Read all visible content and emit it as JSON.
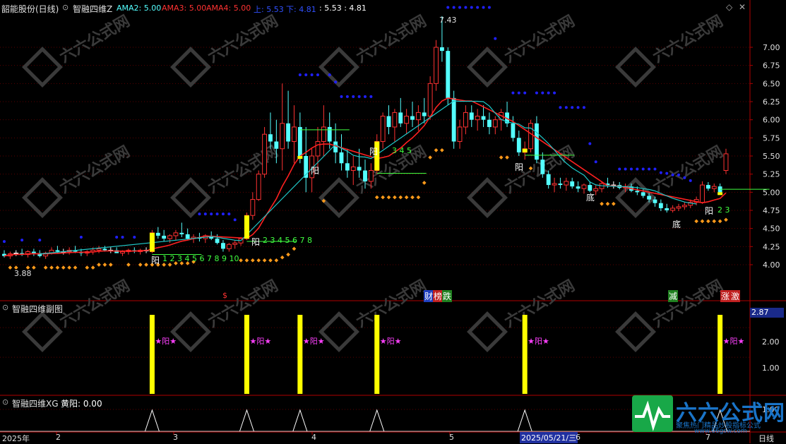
{
  "colors": {
    "bg": "#000000",
    "up": "#ff3232",
    "down": "#54ffff",
    "doji": "#ffffff",
    "grid": "#5a0000",
    "axis": "#b00000",
    "upper_band": "#2020ff",
    "lower_band": "#ff9a1a",
    "ma_red": "#ff2020",
    "ma_cyan": "#20c8c8",
    "yellow": "#ffff00",
    "magenta": "#ff40ff",
    "green": "#40ff40",
    "watermark": "#3a3a3a"
  },
  "header": {
    "stock": "韶能股份(日线)",
    "indicator": "智融四维Z",
    "ama2_label": "AMA2: 5.00",
    "ama3_label": "AMA3: 5.00",
    "ama4_label": "AMA4: 5.00",
    "up_label": "上: 5.53",
    "down_label": "下: 4.81",
    "extra_label": ": 5.53 : 4.81",
    "diamond_icon": "diamond-icon",
    "close_icon": "close-icon"
  },
  "main_panel": {
    "high_label": "7.43",
    "low_label": "3.88",
    "y_ticks": [
      "7.00",
      "6.75",
      "6.50",
      "6.25",
      "6.00",
      "5.75",
      "5.50",
      "5.25",
      "5.00",
      "4.75",
      "4.50",
      "4.25",
      "4.00"
    ],
    "signals": {
      "yang": "阳",
      "di": "底"
    },
    "counters": [
      {
        "text": "1 2 3 4 5 6 7 8 9 10"
      },
      {
        "text": "2 3 4 5 6 7 8"
      },
      {
        "text": "3 4 5"
      },
      {
        "text": "2 3"
      }
    ],
    "bottom_markers": {
      "s": "$",
      "cai": "财",
      "ban": "榜",
      "die": "跌",
      "jian": "减",
      "zhang": "涨",
      "ji": "激"
    }
  },
  "sub_panel": {
    "title": "智融四维副图",
    "value_box": "2.87",
    "y_ticks": [
      "2.00",
      "1.00"
    ],
    "bar_label": "★阳★"
  },
  "xg_panel": {
    "title": "智融四维XG",
    "value_label": "黄阳: 0.00",
    "y_tick": "1.00"
  },
  "x_axis": {
    "labels": [
      "2025年",
      "2",
      "3",
      "4",
      "5",
      "6",
      "7"
    ],
    "date_highlight": "2025/05/21/三",
    "period": "日线"
  },
  "watermark": {
    "logo_text": "六六公式网",
    "slogan": "聚焦热门精品炒股指标公式",
    "url": "www.66gsw.com"
  },
  "chart_data": {
    "type": "candlestick",
    "title": "韶能股份(日线)",
    "ylim": [
      3.7,
      7.5
    ],
    "candles": [
      [
        4.15,
        4.2,
        4.1,
        4.12
      ],
      [
        4.12,
        4.18,
        4.08,
        4.15
      ],
      [
        4.15,
        4.2,
        4.12,
        4.16
      ],
      [
        4.16,
        4.22,
        4.12,
        4.14
      ],
      [
        4.14,
        4.2,
        4.1,
        4.18
      ],
      [
        4.18,
        4.22,
        4.12,
        4.16
      ],
      [
        4.16,
        4.2,
        4.1,
        4.12
      ],
      [
        4.12,
        4.18,
        4.08,
        4.16
      ],
      [
        4.16,
        4.24,
        4.14,
        4.2
      ],
      [
        4.2,
        4.26,
        4.16,
        4.18
      ],
      [
        4.18,
        4.22,
        4.14,
        4.18
      ],
      [
        4.18,
        4.24,
        4.14,
        4.2
      ],
      [
        4.2,
        4.26,
        4.16,
        4.18
      ],
      [
        4.18,
        4.22,
        4.12,
        4.16
      ],
      [
        4.16,
        4.2,
        4.12,
        4.18
      ],
      [
        4.18,
        4.24,
        4.14,
        4.2
      ],
      [
        4.2,
        4.26,
        4.16,
        4.22
      ],
      [
        4.22,
        4.26,
        4.18,
        4.2
      ],
      [
        4.2,
        4.24,
        4.16,
        4.2
      ],
      [
        4.2,
        4.24,
        4.16,
        4.16
      ],
      [
        4.16,
        4.2,
        4.12,
        4.18
      ],
      [
        4.18,
        4.22,
        4.14,
        4.2
      ],
      [
        4.2,
        4.24,
        4.16,
        4.18
      ],
      [
        4.18,
        4.22,
        4.14,
        4.2
      ],
      [
        4.2,
        4.24,
        4.16,
        4.2
      ],
      [
        4.18,
        4.48,
        4.16,
        4.44
      ],
      [
        4.44,
        4.52,
        4.36,
        4.4
      ],
      [
        4.4,
        4.48,
        4.32,
        4.36
      ],
      [
        4.36,
        4.42,
        4.3,
        4.4
      ],
      [
        4.4,
        4.48,
        4.34,
        4.44
      ],
      [
        4.44,
        4.58,
        4.38,
        4.42
      ],
      [
        4.42,
        4.5,
        4.34,
        4.36
      ],
      [
        4.36,
        4.42,
        4.3,
        4.38
      ],
      [
        4.38,
        4.44,
        4.32,
        4.36
      ],
      [
        4.36,
        4.42,
        4.3,
        4.4
      ],
      [
        4.4,
        4.46,
        4.34,
        4.36
      ],
      [
        4.36,
        4.42,
        4.28,
        4.3
      ],
      [
        4.3,
        4.34,
        4.18,
        4.22
      ],
      [
        4.22,
        4.3,
        4.18,
        4.28
      ],
      [
        4.28,
        4.34,
        4.22,
        4.3
      ],
      [
        4.3,
        4.38,
        4.26,
        4.36
      ],
      [
        4.36,
        4.72,
        4.34,
        4.68
      ],
      [
        4.68,
        5.0,
        4.62,
        4.9
      ],
      [
        4.9,
        5.3,
        4.88,
        5.25
      ],
      [
        5.25,
        5.9,
        5.2,
        5.8
      ],
      [
        5.8,
        6.1,
        5.6,
        5.7
      ],
      [
        5.7,
        6.0,
        5.4,
        5.6
      ],
      [
        5.6,
        6.5,
        5.3,
        5.95
      ],
      [
        5.95,
        6.4,
        5.6,
        5.7
      ],
      [
        5.7,
        6.2,
        5.4,
        5.9
      ],
      [
        5.9,
        6.1,
        5.4,
        5.5
      ],
      [
        5.5,
        5.9,
        5.0,
        5.2
      ],
      [
        5.2,
        5.6,
        5.0,
        5.5
      ],
      [
        5.5,
        5.9,
        5.3,
        5.7
      ],
      [
        5.7,
        6.2,
        5.5,
        5.9
      ],
      [
        5.9,
        6.1,
        5.6,
        5.7
      ],
      [
        5.7,
        5.95,
        5.4,
        5.55
      ],
      [
        5.55,
        5.8,
        5.3,
        5.4
      ],
      [
        5.4,
        5.6,
        5.2,
        5.3
      ],
      [
        5.3,
        5.5,
        5.1,
        5.35
      ],
      [
        5.35,
        5.6,
        5.2,
        5.3
      ],
      [
        5.3,
        5.45,
        5.05,
        5.15
      ],
      [
        5.15,
        5.4,
        5.05,
        5.3
      ],
      [
        5.3,
        5.8,
        5.25,
        5.7
      ],
      [
        5.7,
        6.1,
        5.6,
        6.05
      ],
      [
        6.05,
        6.2,
        5.8,
        5.9
      ],
      [
        5.9,
        6.15,
        5.7,
        6.1
      ],
      [
        6.1,
        6.3,
        5.9,
        5.95
      ],
      [
        5.95,
        6.15,
        5.8,
        6.05
      ],
      [
        6.05,
        6.25,
        5.9,
        6.0
      ],
      [
        6.0,
        6.2,
        5.85,
        6.1
      ],
      [
        6.1,
        6.3,
        5.95,
        6.05
      ],
      [
        6.05,
        6.6,
        6.0,
        6.5
      ],
      [
        6.5,
        7.1,
        6.4,
        7.0
      ],
      [
        7.0,
        7.43,
        6.8,
        6.95
      ],
      [
        6.95,
        7.0,
        6.2,
        6.3
      ],
      [
        6.3,
        6.4,
        5.6,
        5.7
      ],
      [
        5.7,
        6.0,
        5.6,
        5.9
      ],
      [
        5.9,
        6.2,
        5.8,
        6.1
      ],
      [
        6.1,
        6.2,
        5.9,
        6.0
      ],
      [
        6.0,
        6.15,
        5.85,
        6.05
      ],
      [
        6.05,
        6.2,
        5.9,
        6.0
      ],
      [
        6.0,
        6.1,
        5.8,
        5.9
      ],
      [
        5.9,
        6.05,
        5.8,
        6.0
      ],
      [
        6.0,
        6.15,
        5.85,
        6.1
      ],
      [
        6.1,
        6.25,
        5.9,
        5.95
      ],
      [
        5.95,
        6.05,
        5.7,
        5.75
      ],
      [
        5.75,
        5.85,
        5.5,
        5.55
      ],
      [
        5.55,
        5.7,
        5.45,
        5.6
      ],
      [
        5.6,
        6.0,
        5.55,
        5.95
      ],
      [
        5.95,
        6.05,
        5.4,
        5.45
      ],
      [
        5.45,
        5.55,
        5.2,
        5.25
      ],
      [
        5.25,
        5.3,
        5.05,
        5.1
      ],
      [
        5.1,
        5.2,
        5.0,
        5.12
      ],
      [
        5.12,
        5.2,
        5.05,
        5.1
      ],
      [
        5.1,
        5.2,
        5.02,
        5.15
      ],
      [
        5.15,
        5.2,
        5.05,
        5.08
      ],
      [
        5.08,
        5.15,
        5.0,
        5.05
      ],
      [
        5.05,
        5.12,
        4.98,
        5.1
      ],
      [
        5.1,
        5.15,
        5.0,
        5.02
      ],
      [
        5.02,
        5.1,
        4.96,
        5.05
      ],
      [
        5.05,
        5.15,
        5.0,
        5.12
      ],
      [
        5.12,
        5.2,
        5.06,
        5.1
      ],
      [
        5.1,
        5.15,
        5.05,
        5.1
      ],
      [
        5.1,
        5.14,
        5.04,
        5.06
      ],
      [
        5.06,
        5.12,
        5.0,
        5.08
      ],
      [
        5.08,
        5.12,
        5.0,
        5.02
      ],
      [
        5.02,
        5.08,
        4.96,
        5.0
      ],
      [
        5.0,
        5.04,
        4.92,
        4.95
      ],
      [
        4.95,
        5.0,
        4.86,
        4.9
      ],
      [
        4.9,
        4.94,
        4.8,
        4.85
      ],
      [
        4.85,
        4.9,
        4.74,
        4.78
      ],
      [
        4.78,
        4.84,
        4.72,
        4.75
      ],
      [
        4.75,
        4.82,
        4.72,
        4.78
      ],
      [
        4.78,
        4.84,
        4.74,
        4.8
      ],
      [
        4.8,
        4.86,
        4.76,
        4.82
      ],
      [
        4.82,
        4.9,
        4.78,
        4.86
      ],
      [
        4.86,
        4.94,
        4.82,
        4.9
      ],
      [
        4.86,
        5.15,
        4.84,
        5.1
      ],
      [
        5.1,
        5.14,
        5.02,
        5.05
      ],
      [
        5.05,
        5.12,
        5.0,
        5.08
      ],
      [
        5.08,
        5.12,
        4.98,
        5.0
      ],
      [
        5.3,
        5.6,
        5.25,
        5.53
      ]
    ],
    "signal_indices": [
      25,
      41,
      50,
      63,
      88,
      121
    ]
  }
}
